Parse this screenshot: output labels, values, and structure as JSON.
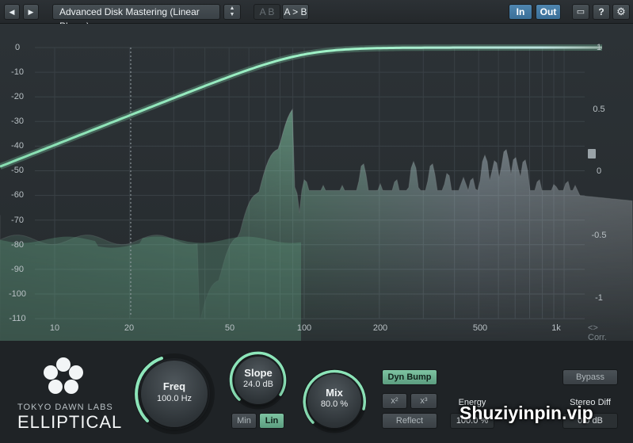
{
  "topbar": {
    "back_glyph": "◀",
    "fwd_glyph": "▶",
    "preset_name": "Advanced Disk Mastering (Linear Phase)",
    "stepper_up": "▲",
    "stepper_down": "▼",
    "ab_label": "A B",
    "a_to_b_label": "A > B",
    "in_label": "In",
    "out_label": "Out",
    "help_label": "?",
    "settings_glyph": "⚙",
    "screen_glyph": "▭"
  },
  "graph": {
    "db_scale": [
      "0",
      "-10",
      "-20",
      "-30",
      "-40",
      "-50",
      "-60",
      "-70",
      "-80",
      "-90",
      "-100",
      "-110"
    ],
    "corr_scale": [
      "1",
      "0.5",
      "0",
      "-0.5",
      "-1"
    ],
    "freq_scale": [
      "10",
      "20",
      "50",
      "100",
      "200",
      "500",
      "1k"
    ],
    "corr_label": "<> Corr.",
    "colors": {
      "curve": "#9ef0c4",
      "spectrum_hi": "#d9e6ee",
      "spectrum_lo": "#7fd2a8",
      "background": "#2a2f33"
    }
  },
  "controls": {
    "freq": {
      "label": "Freq",
      "value": "100.0 Hz"
    },
    "slope": {
      "label": "Slope",
      "value": "24.0 dB"
    },
    "mix": {
      "label": "Mix",
      "value": "80.0 %"
    },
    "min_label": "Min",
    "lin_label": "Lin",
    "dyn_bump_label": "Dyn Bump",
    "x2_label": "x²",
    "x3_label": "x³",
    "reflect_label": "Reflect",
    "energy_label": "Energy",
    "energy_value": "100.0 %",
    "bypass_label": "Bypass",
    "stereo_diff_label": "Stereo Diff",
    "stereo_diff_value": "0.0 dB"
  },
  "brand": {
    "company": "TOKYO DAWN LABS",
    "product": "ELLIPTICAL"
  },
  "watermark": "Shuziyinpin.vip"
}
